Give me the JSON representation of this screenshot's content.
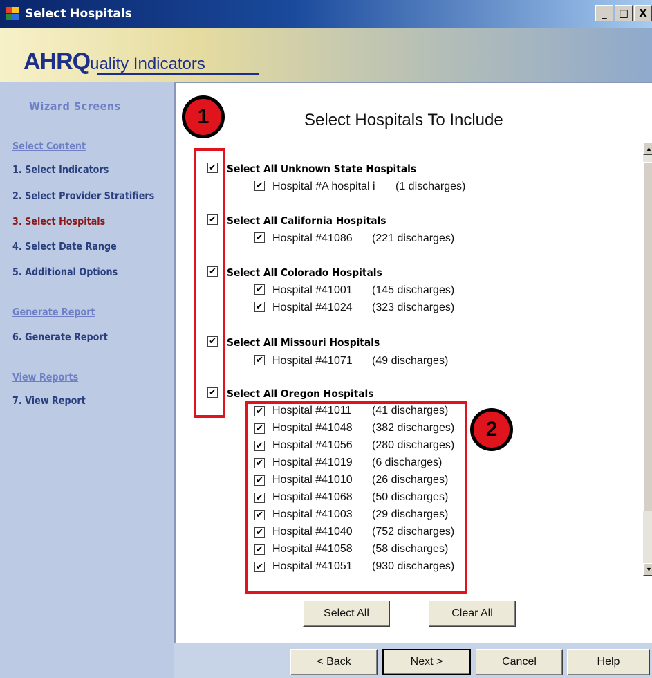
{
  "window": {
    "title": "Select Hospitals",
    "controls": [
      "_",
      "□",
      "X"
    ]
  },
  "banner": {
    "logo_ahr": "AHRQ",
    "logo_rest": "uality Indicators"
  },
  "sidebar": {
    "heading": "Wizard Screens",
    "items": [
      {
        "label": "Select Content",
        "type": "section"
      },
      {
        "label": "1. Select Indicators",
        "type": "step"
      },
      {
        "label": "2. Select Provider Stratifiers",
        "type": "step"
      },
      {
        "label": "3. Select Hospitals",
        "type": "step",
        "active": true
      },
      {
        "label": "4. Select Date Range",
        "type": "step"
      },
      {
        "label": "5. Additional Options",
        "type": "step"
      },
      {
        "label": "Generate Report",
        "type": "section"
      },
      {
        "label": "6. Generate Report",
        "type": "step"
      },
      {
        "label": "View Reports",
        "type": "section"
      },
      {
        "label": "7. View Report",
        "type": "step"
      }
    ]
  },
  "main": {
    "title": "Select Hospitals To Include",
    "checkmark": "✔",
    "groups": [
      {
        "label": "Select All Unknown State Hospitals",
        "hospitals": [
          {
            "name": "Hospital #A hospital i",
            "discharges": "(1 discharges)"
          }
        ]
      },
      {
        "label": "Select All California Hospitals",
        "hospitals": [
          {
            "name": "Hospital #41086",
            "discharges": "(221 discharges)"
          }
        ]
      },
      {
        "label": "Select All Colorado Hospitals",
        "hospitals": [
          {
            "name": "Hospital #41001",
            "discharges": "(145 discharges)"
          },
          {
            "name": "Hospital #41024",
            "discharges": "(323 discharges)"
          }
        ]
      },
      {
        "label": "Select All Missouri Hospitals",
        "hospitals": [
          {
            "name": "Hospital #41071",
            "discharges": "(49 discharges)"
          }
        ]
      },
      {
        "label": "Select All Oregon Hospitals",
        "hospitals": [
          {
            "name": "Hospital #41011",
            "discharges": "(41 discharges)"
          },
          {
            "name": "Hospital #41048",
            "discharges": "(382 discharges)"
          },
          {
            "name": "Hospital #41056",
            "discharges": "(280 discharges)"
          },
          {
            "name": "Hospital #41019",
            "discharges": "(6 discharges)"
          },
          {
            "name": "Hospital #41010",
            "discharges": "(26 discharges)"
          },
          {
            "name": "Hospital #41068",
            "discharges": "(50 discharges)"
          },
          {
            "name": "Hospital #41003",
            "discharges": "(29 discharges)"
          },
          {
            "name": "Hospital #41040",
            "discharges": "(752 discharges)"
          },
          {
            "name": "Hospital #41058",
            "discharges": "(58 discharges)"
          },
          {
            "name": "Hospital #41051",
            "discharges": "(930 discharges)"
          }
        ]
      }
    ],
    "select_all_label": "Select All",
    "clear_all_label": "Clear All"
  },
  "annotations": {
    "callout_1": "1",
    "callout_2": "2",
    "color": "#e0141c"
  },
  "footer": {
    "back_label": "< Back",
    "next_label": "Next >",
    "cancel_label": "Cancel",
    "help_label": "Help"
  }
}
